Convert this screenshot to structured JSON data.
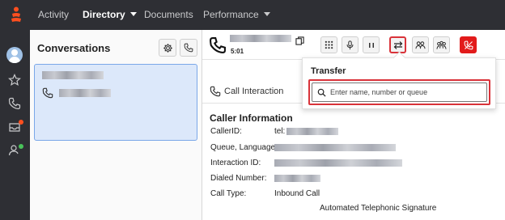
{
  "nav": {
    "items": [
      {
        "label": "Activity"
      },
      {
        "label": "Directory"
      },
      {
        "label": "Documents"
      },
      {
        "label": "Performance"
      }
    ]
  },
  "conversations": {
    "title": "Conversations"
  },
  "call": {
    "timer": "5:01"
  },
  "interaction": {
    "tab_label": "Call Interaction"
  },
  "transfer": {
    "title": "Transfer",
    "search_placeholder": "Enter name, number or queue"
  },
  "caller_info": {
    "title": "Caller Information",
    "fields": [
      {
        "label": "CallerID:",
        "value": "tel:"
      },
      {
        "label": "Queue, Language:",
        "value": ""
      },
      {
        "label": "Interaction ID:",
        "value": ""
      },
      {
        "label": "Dialed Number:",
        "value": ""
      },
      {
        "label": "Call Type:",
        "value": "Inbound Call"
      }
    ],
    "signature": "Automated Telephonic Signature"
  },
  "colors": {
    "nav_bg": "#2e2f34",
    "accent_orange": "#ff4f1f",
    "highlight_red": "#d9333a",
    "end_call_red": "#e21b1b",
    "selected_card": "#dce8fa"
  }
}
